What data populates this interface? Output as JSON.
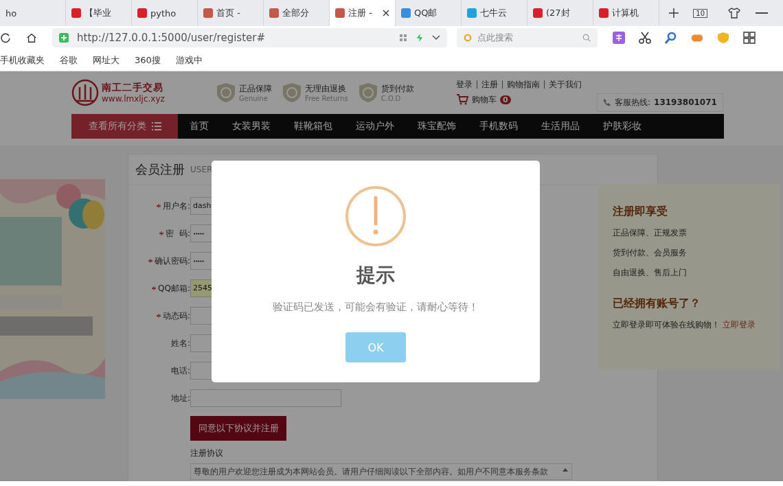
{
  "browser": {
    "tabs": [
      {
        "label": "ho",
        "selected": false
      },
      {
        "label": "【毕业",
        "selected": false,
        "color": "#d9202a"
      },
      {
        "label": "pytho",
        "selected": false,
        "color": "#d9202a"
      },
      {
        "label": "首页 -",
        "selected": false,
        "color": "#c4584a"
      },
      {
        "label": "全部分",
        "selected": false,
        "color": "#c4584a"
      },
      {
        "label": "注册 -",
        "selected": true,
        "color": "#c4584a"
      },
      {
        "label": "QQ邮",
        "selected": false,
        "color": "#3c8de0"
      },
      {
        "label": "七牛云",
        "selected": false,
        "color": "#1ea3e0"
      },
      {
        "label": "(27封",
        "selected": false,
        "color": "#d9202a"
      },
      {
        "label": "计算机",
        "selected": false,
        "color": "#d9202a"
      }
    ],
    "tab_count": "10",
    "url": "http://127.0.0.1:5000/user/register#",
    "search_placeholder": "点此搜索",
    "bookmarks": [
      "手机收藏夹",
      "谷歌",
      "网址大",
      "360搜",
      "游戏中"
    ]
  },
  "site": {
    "logo_name": "南工二手交易",
    "logo_url": "www.lmxljc.xyz",
    "guarantees": [
      {
        "title": "正品保障",
        "subtitle": "Genuine"
      },
      {
        "title": "无理由退换",
        "subtitle": "Free Returns"
      },
      {
        "title": "货到付款",
        "subtitle": "C.O.D"
      }
    ],
    "top_links": [
      "登录",
      "注册",
      "购物指南",
      "关于我们"
    ],
    "cart_label": "购物车",
    "cart_count": "0",
    "hotline_label": "客服热线:",
    "hotline_number": "13193801071",
    "category_button": "查看所有分类",
    "nav": [
      "首页",
      "女装男装",
      "鞋靴箱包",
      "运动户外",
      "珠宝配饰",
      "手机数码",
      "生活用品",
      "护肤彩妆"
    ]
  },
  "form": {
    "title": "会员注册",
    "subtitle": "USER",
    "fields": [
      {
        "label": "用户名:",
        "required": true,
        "value": "dash",
        "highlighted": false
      },
      {
        "label": "密  码:",
        "required": true,
        "value": "•••••",
        "highlighted": false
      },
      {
        "label": "确认密码:",
        "required": true,
        "value": "•••••",
        "highlighted": false
      },
      {
        "label": "QQ邮箱:",
        "required": true,
        "value": "2545",
        "highlighted": true
      },
      {
        "label": "动态码:",
        "required": true,
        "highlighted": false
      },
      {
        "label": "姓名:",
        "required": false,
        "highlighted": false
      },
      {
        "label": "电话:",
        "required": false,
        "highlighted": false
      },
      {
        "label": "地址:",
        "required": false,
        "highlighted": false
      }
    ],
    "submit": "同意以下协议并注册",
    "agreement_label": "注册协议",
    "agreement_text": "尊敬的用户欢迎您注册成为本网站会员。请用户仔细阅读以下全部内容。如用户不同意本服务条款"
  },
  "side": {
    "title": "注册即享受",
    "benefits": [
      "正品保障、正规发票",
      "货到付款、会员服务",
      "自由退换、售后上门"
    ],
    "login_title": "已经拥有账号了？",
    "login_text": "立即登录即可体验在线购物！",
    "login_link": "立即登录"
  },
  "dialog": {
    "title": "提示",
    "message": "验证码已发送，可能会有验证，请耐心等待！",
    "ok": "OK"
  }
}
